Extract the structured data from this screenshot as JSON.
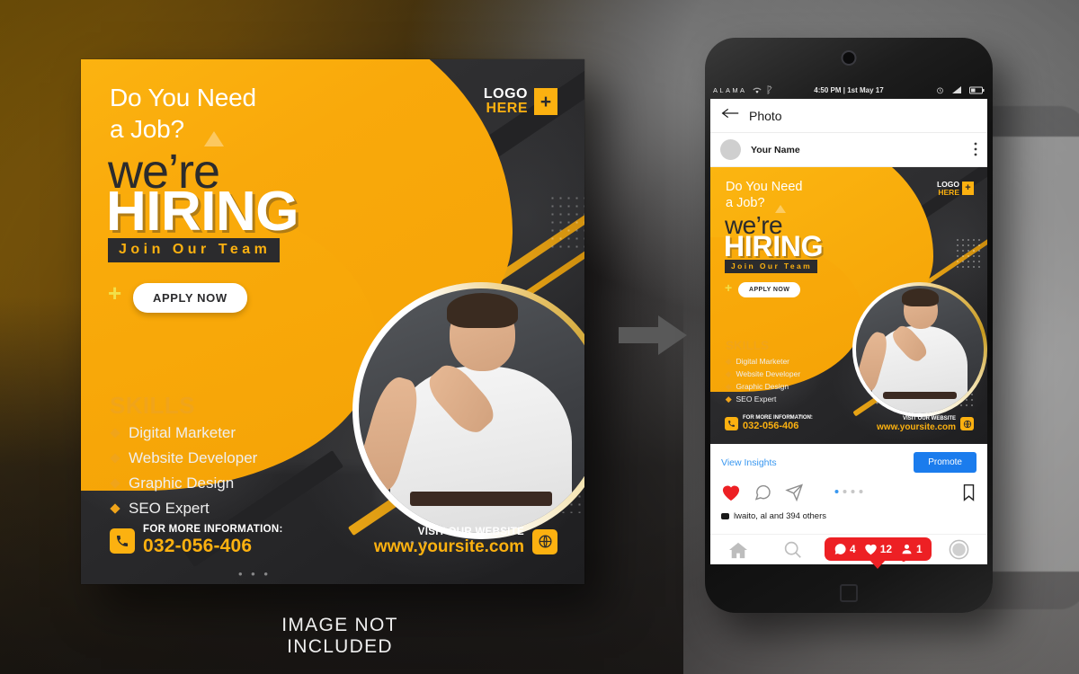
{
  "background": {
    "caption": "IMAGE NOT INCLUDED",
    "arrow_icon": "right-arrow-icon"
  },
  "colors": {
    "brand_yellow": "#fcb110",
    "poster_dark": "#2b2b2d",
    "accent_gold": "#f0a41a",
    "link_blue": "#3897f0",
    "promote_blue": "#1b7ced",
    "notification_red": "#ed2024"
  },
  "poster": {
    "headline_line1": "Do You Need",
    "headline_line2": "a Job?",
    "were": "we’re",
    "hiring": "HIRING",
    "tagline": "Join Our Team",
    "apply_button": "APPLY NOW",
    "plus_mark": "+",
    "logo": {
      "line1": "LOGO",
      "line2": "HERE",
      "mark": "+"
    },
    "skills_title": "SKILLS",
    "skills": [
      "Digital Marketer",
      "Website Developer",
      "Graphic Design",
      "SEO Expert"
    ],
    "contact": {
      "label": "FOR MORE INFORMATION:",
      "phone": "032-056-406",
      "icon": "phone-icon"
    },
    "website": {
      "label": "VISIT OUR WEBSITE",
      "url": "www.yoursite.com",
      "icon": "globe-icon"
    }
  },
  "phone": {
    "status_bar": {
      "carrier": "ALAMA",
      "wifi_icon": "wifi-icon",
      "bluetooth_icon": "bluetooth-icon",
      "time": "4:50 PM | 1st May 17",
      "alarm_icon": "alarm-icon",
      "signal_icon": "signal-icon",
      "battery_icon": "battery-icon"
    },
    "nav_header": {
      "back_icon": "back-arrow-icon",
      "title": "Photo"
    },
    "post_header": {
      "username": "Your Name",
      "avatar": "avatar-icon",
      "more_icon": "more-vertical-icon"
    },
    "insights": {
      "view_insights": "View Insights",
      "promote": "Promote"
    },
    "actions": {
      "like_icon": "heart-filled-icon",
      "comment_icon": "comment-icon",
      "share_icon": "send-icon",
      "bookmark_icon": "bookmark-icon"
    },
    "carousel_dots": 4,
    "carousel_active_index": 0,
    "notification_badge": {
      "comments": "4",
      "likes": "12",
      "followers": "1",
      "comment_icon": "comment-filled-icon",
      "heart_icon": "heart-filled-icon",
      "person_icon": "person-icon"
    },
    "likes_line": "lwaito, al  and 394 others",
    "bottom_nav": [
      {
        "name": "home",
        "icon": "home-icon"
      },
      {
        "name": "search",
        "icon": "search-icon"
      },
      {
        "name": "add",
        "icon": "plus-square-icon"
      },
      {
        "name": "activity",
        "icon": "heart-icon"
      },
      {
        "name": "profile",
        "icon": "profile-circle-icon"
      }
    ],
    "home_button_icon": "square-home-icon"
  },
  "mini_poster": {
    "headline_line1": "Do You Need",
    "headline_line2": "a Job?",
    "were": "we’re",
    "hiring": "HIRING",
    "tagline": "Join Our Team",
    "apply_button": "APPLY NOW",
    "plus_mark": "+",
    "logo": {
      "line1": "LOGO",
      "line2": "HERE",
      "mark": "+"
    },
    "skills_title": "SKILLS",
    "skills": [
      "Digital Marketer",
      "Website Developer",
      "Graphic Design",
      "SEO Expert"
    ],
    "contact": {
      "label": "FOR MORE INFORMATION:",
      "phone": "032-056-406"
    },
    "website": {
      "label": "VISIT OUR WEBSITE",
      "url": "www.yoursite.com"
    }
  }
}
